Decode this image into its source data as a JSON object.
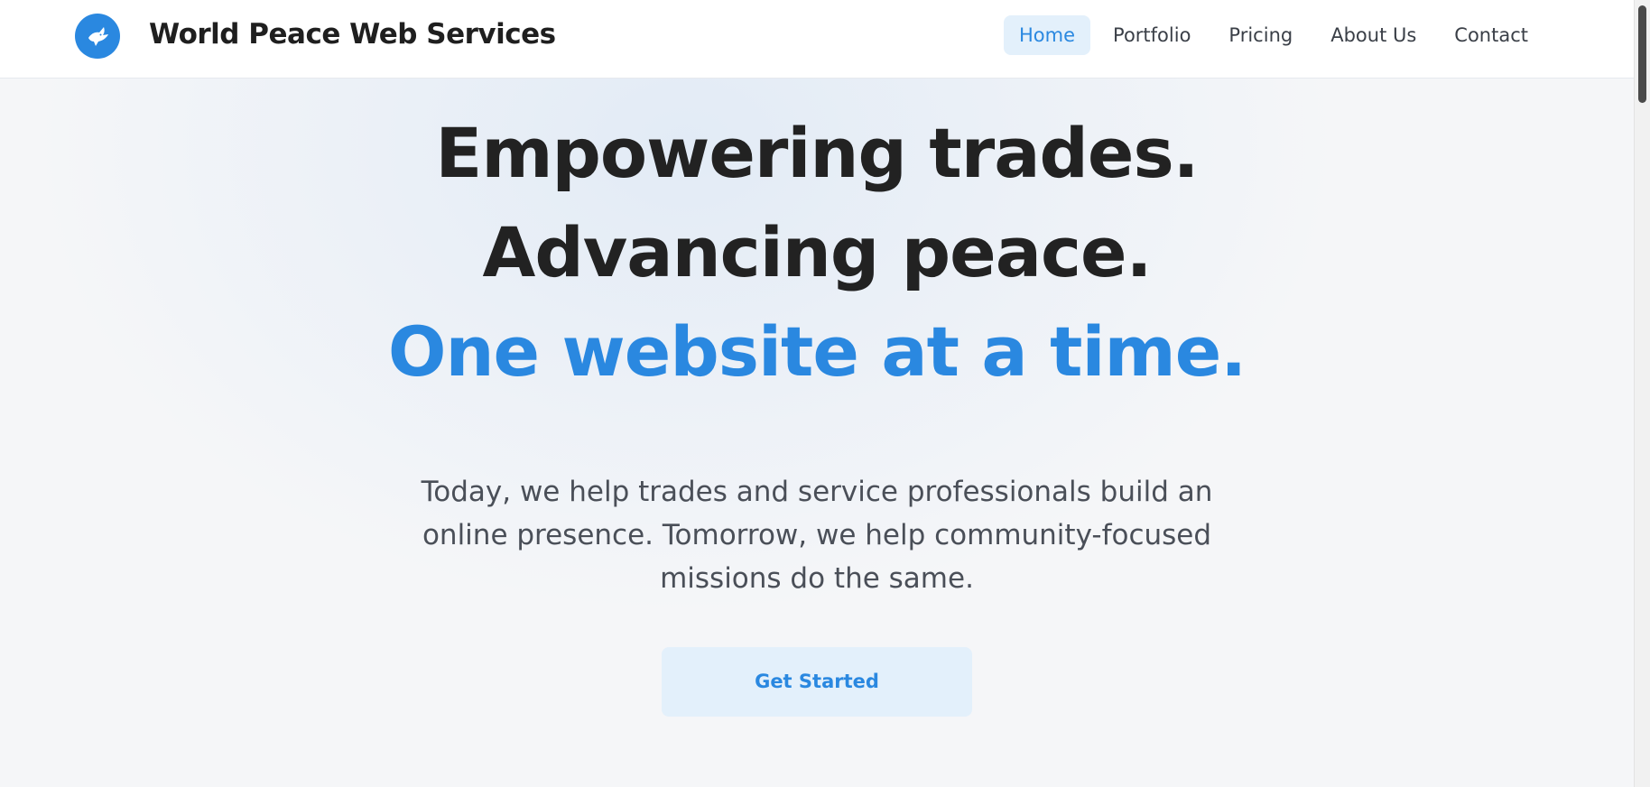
{
  "header": {
    "brand": "World Peace Web Services",
    "logo_icon": "dove-icon",
    "nav": [
      {
        "label": "Home",
        "active": true
      },
      {
        "label": "Portfolio",
        "active": false
      },
      {
        "label": "Pricing",
        "active": false
      },
      {
        "label": "About Us",
        "active": false
      },
      {
        "label": "Contact",
        "active": false
      }
    ]
  },
  "hero": {
    "line1": "Empowering trades.",
    "line2": "Advancing peace.",
    "line3": "One website at a time.",
    "subtitle": "Today, we help trades and service professionals build an online presence. Tomorrow, we help community-focused missions do the same.",
    "cta_label": "Get Started"
  },
  "colors": {
    "accent": "#2a88e0",
    "accent_soft": "#e3f0fb",
    "heading": "#222222",
    "body_text": "#4a4f58"
  }
}
